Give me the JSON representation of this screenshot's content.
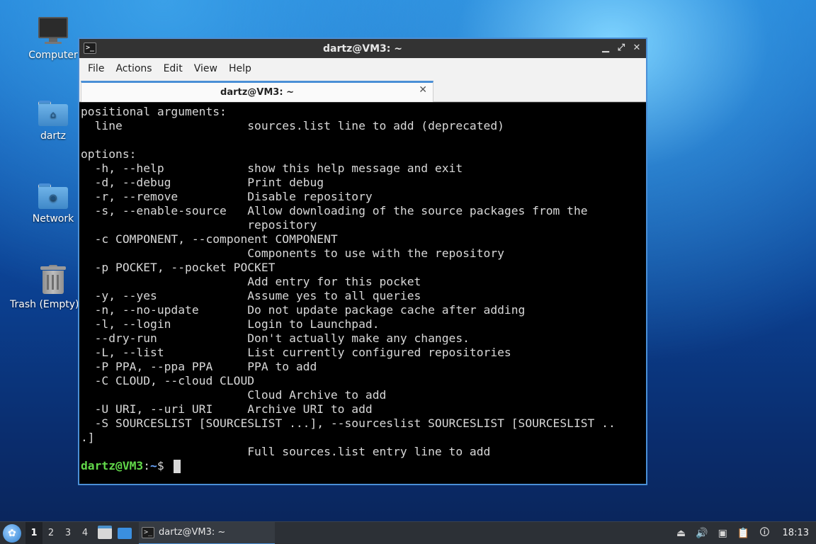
{
  "desktop": {
    "icons": [
      {
        "label": "Computer",
        "icon": "computer-icon"
      },
      {
        "label": "dartz",
        "icon": "home-folder-icon"
      },
      {
        "label": "Network",
        "icon": "network-folder-icon"
      },
      {
        "label": "Trash (Empty)",
        "icon": "trash-icon"
      }
    ]
  },
  "window": {
    "title": "dartz@VM3: ~",
    "controls": {
      "minimize": "▁",
      "maximize": "⤢",
      "close": "✕"
    },
    "menu": [
      "File",
      "Actions",
      "Edit",
      "View",
      "Help"
    ],
    "tab": {
      "label": "dartz@VM3: ~",
      "close": "✕"
    }
  },
  "terminal": {
    "lines": [
      "positional arguments:",
      "  line                  sources.list line to add (deprecated)",
      "",
      "options:",
      "  -h, --help            show this help message and exit",
      "  -d, --debug           Print debug",
      "  -r, --remove          Disable repository",
      "  -s, --enable-source   Allow downloading of the source packages from the",
      "                        repository",
      "  -c COMPONENT, --component COMPONENT",
      "                        Components to use with the repository",
      "  -p POCKET, --pocket POCKET",
      "                        Add entry for this pocket",
      "  -y, --yes             Assume yes to all queries",
      "  -n, --no-update       Do not update package cache after adding",
      "  -l, --login           Login to Launchpad.",
      "  --dry-run             Don't actually make any changes.",
      "  -L, --list            List currently configured repositories",
      "  -P PPA, --ppa PPA     PPA to add",
      "  -C CLOUD, --cloud CLOUD",
      "                        Cloud Archive to add",
      "  -U URI, --uri URI     Archive URI to add",
      "  -S SOURCESLIST [SOURCESLIST ...], --sourceslist SOURCESLIST [SOURCESLIST ..",
      ".]",
      "                        Full sources.list entry line to add"
    ],
    "prompt": {
      "user_host": "dartz@VM3",
      "colon": ":",
      "path": "~",
      "dollar": "$ "
    }
  },
  "taskbar": {
    "start_icon": "lubuntu-start-icon",
    "workspaces": [
      "1",
      "2",
      "3",
      "4"
    ],
    "active_workspace": "1",
    "task_label": "dartz@VM3: ~",
    "tray": {
      "clock": "18:13"
    }
  },
  "colors": {
    "accent": "#4a8fd6",
    "prompt_user": "#62d94a",
    "prompt_path": "#6aa6ff"
  }
}
